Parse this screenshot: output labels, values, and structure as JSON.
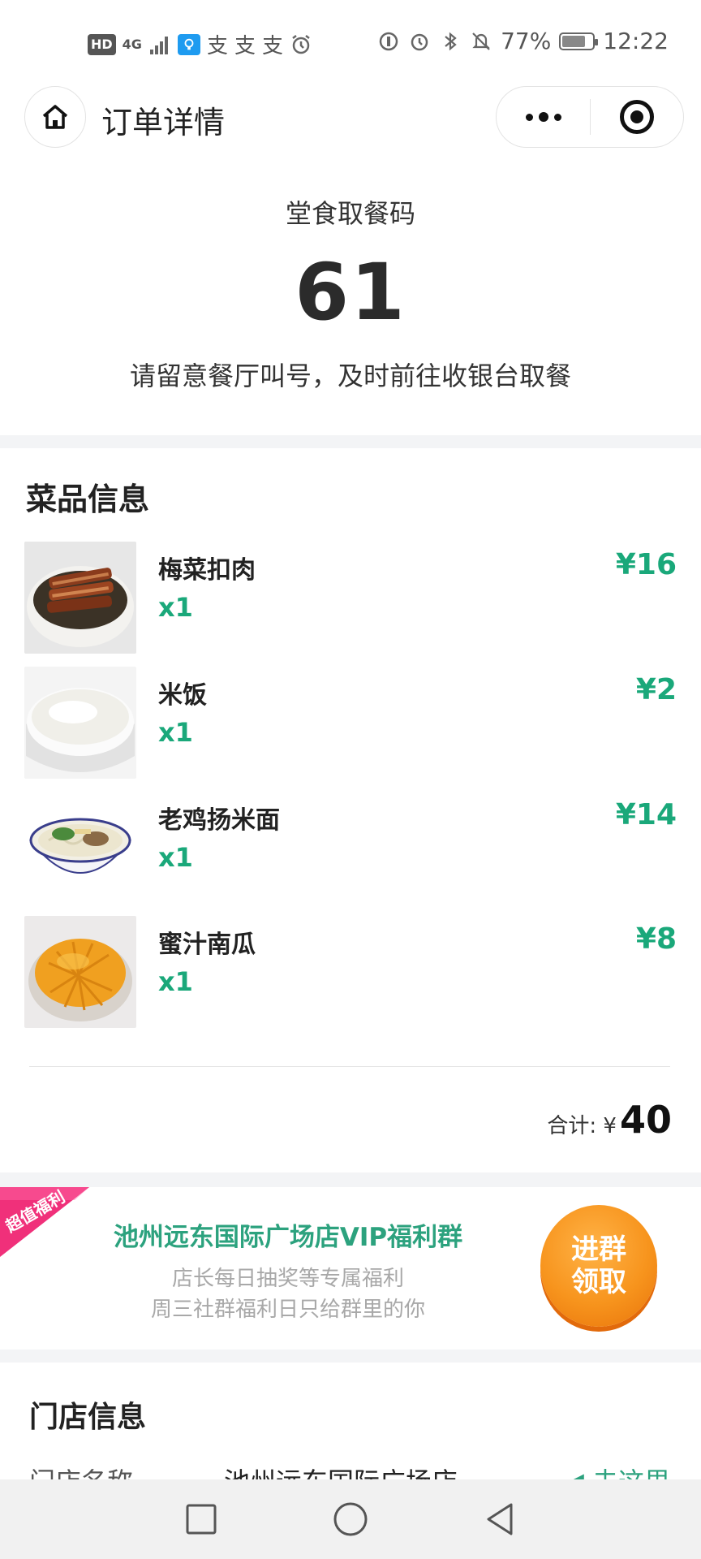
{
  "status_bar": {
    "left_chip": "HD",
    "network": "4G",
    "pay_icons": [
      "支",
      "支",
      "支"
    ],
    "battery": "77%",
    "battery_level": 0.77,
    "time": "12:22"
  },
  "nav": {
    "title": "订单详情"
  },
  "pickup": {
    "label": "堂食取餐码",
    "code": "61",
    "tip": "请留意餐厅叫号，及时前往收银台取餐"
  },
  "dishes": {
    "title": "菜品信息",
    "items": [
      {
        "name": "梅菜扣肉",
        "qty": "x1",
        "price": "¥16"
      },
      {
        "name": "米饭",
        "qty": "x1",
        "price": "¥2"
      },
      {
        "name": "老鸡扬米面",
        "qty": "x1",
        "price": "¥14"
      },
      {
        "name": "蜜汁南瓜",
        "qty": "x1",
        "price": "¥8"
      }
    ],
    "total_label": "合计: ¥",
    "total_value": "40"
  },
  "promo": {
    "ribbon_text": "超值福利",
    "title": "池州远东国际广场店VIP福利群",
    "line1": "店长每日抽奖等专属福利",
    "line2": "周三社群福利日只给群里的你",
    "button_line1": "进群",
    "button_line2": "领取"
  },
  "store": {
    "title": "门店信息",
    "name_key": "门店名称",
    "name_value": "池州远东国际广场店",
    "nav_text": "去这里"
  },
  "colors": {
    "accent_green": "#1aa87a",
    "promo_green": "#2ca27e",
    "orange": "#f7941d",
    "pink": "#f0307a"
  }
}
